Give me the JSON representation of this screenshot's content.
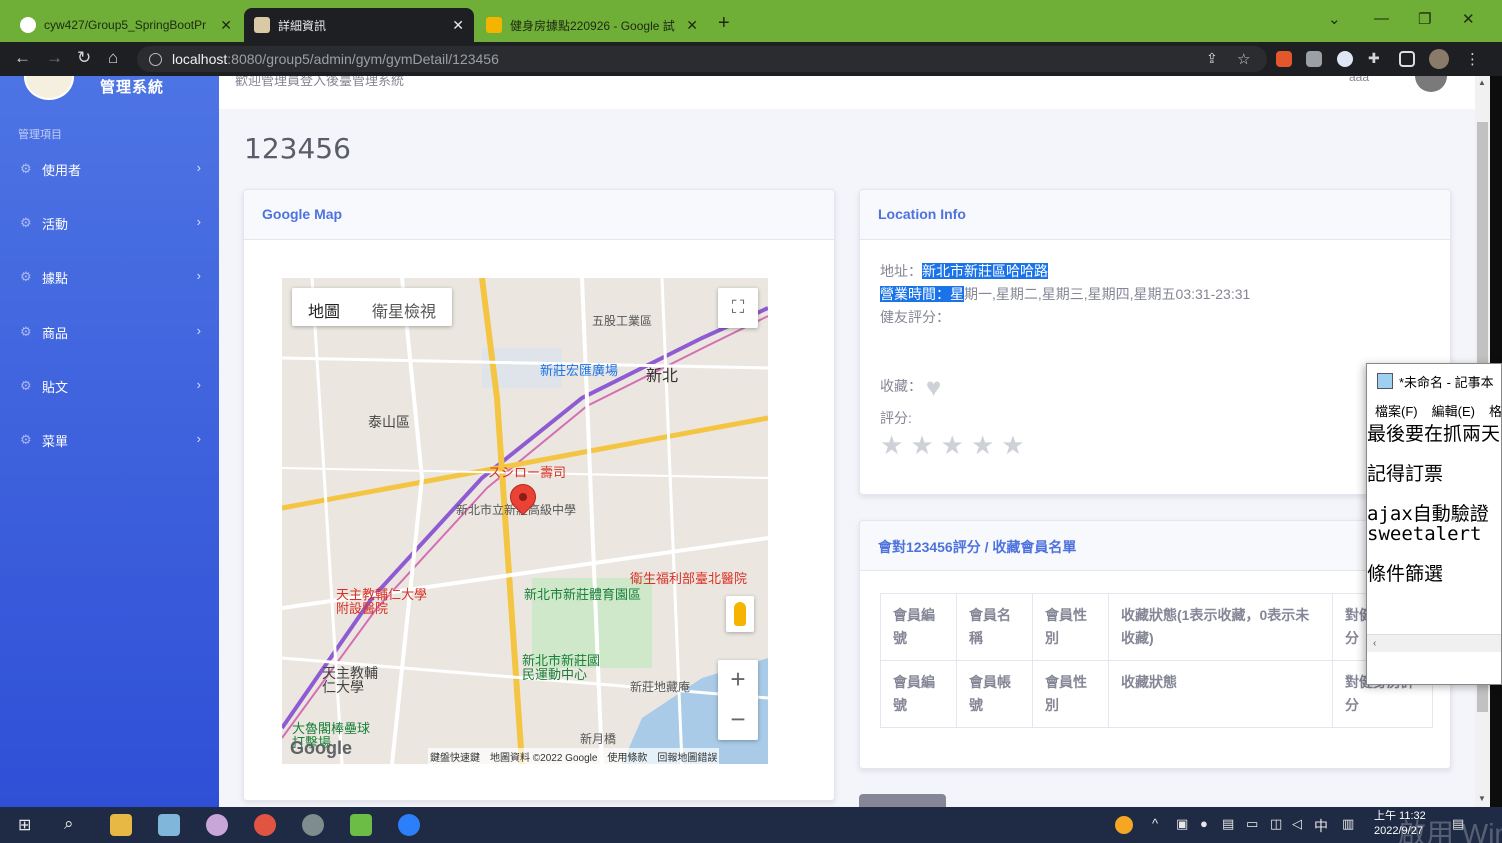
{
  "browser": {
    "tabs": [
      {
        "title": "cyw427/Group5_SpringBootPr",
        "close": "✕"
      },
      {
        "title": "詳細資訊",
        "close": "✕"
      },
      {
        "title": "健身房據點220926 - Google 試",
        "close": "✕"
      }
    ],
    "url_host": "localhost",
    "url_path": ":8080/group5/admin/gym/gymDetail/123456"
  },
  "sidebar": {
    "brand": "管理系統",
    "section_label": "管理項目",
    "items": [
      {
        "label": "使用者"
      },
      {
        "label": "活動"
      },
      {
        "label": "據點"
      },
      {
        "label": "商品"
      },
      {
        "label": "貼文"
      },
      {
        "label": "菜單"
      }
    ]
  },
  "topbar": {
    "welcome": "歡迎管理員登入後臺管理系統",
    "username": "aaa"
  },
  "page": {
    "title": "123456"
  },
  "map_card": {
    "header": "Google Map",
    "btn_map": "地圖",
    "btn_satellite": "衛星檢視",
    "labels": {
      "xinzhuang_plaza": "新莊宏匯廣場",
      "xinbei": "新北",
      "taishan": "泰山區",
      "wugu": "五股工業區",
      "sushiro": "スシロー壽司",
      "high_school": "新北市立新莊高級中學",
      "sports_park": "新北市新莊體育園區",
      "hospital_fju": "天主教輔仁大學附設醫院",
      "hospital_mohw": "衛生福利部臺北醫院",
      "sports_center": "新北市新莊國民運動中心",
      "fju": "天主教輔仁大學",
      "baseball": "大魯閣棒壘球打擊場",
      "xinyue": "新月橋",
      "xinzhuang_temple": "新莊地藏庵"
    },
    "google": "Google",
    "attribution": "鍵盤快速鍵　地圖資料 ©2022 Google　使用條款　回報地圖錯誤"
  },
  "location_card": {
    "header": "Location Info",
    "address_label": "地址：",
    "address": "新北市新莊區哈哈路",
    "hours_label_sel": "營業時間：星",
    "hours_rest": "期一,星期二,星期三,星期四,星期五03:31-23:31",
    "review_label": "健友評分：",
    "favorite_label": "收藏：",
    "score_label": "評分:",
    "rating": 0
  },
  "member_card": {
    "header": "會對123456評分 / 收藏會員名單",
    "header_row": [
      "會員編號",
      "會員名稱",
      "會員性別",
      "收藏狀態(1表示收藏，0表示未收藏)",
      "對健身房評分"
    ],
    "footer_row": [
      "會員編號",
      "會員帳號",
      "會員性別",
      "收藏狀態",
      "對健身房評分"
    ]
  },
  "notepad": {
    "title": "*未命名 - 記事本",
    "menu": [
      "檔案(F)",
      "編輯(E)",
      "格"
    ],
    "lines": [
      "最後要在抓兩天",
      "記得訂票",
      "ajax自動驗證 淡",
      "sweetalert",
      "條件篩選"
    ]
  },
  "taskbar": {
    "ime": "中",
    "time": "上午 11:32",
    "date": "2022/9/27",
    "watermark": "啟用 Windo"
  }
}
